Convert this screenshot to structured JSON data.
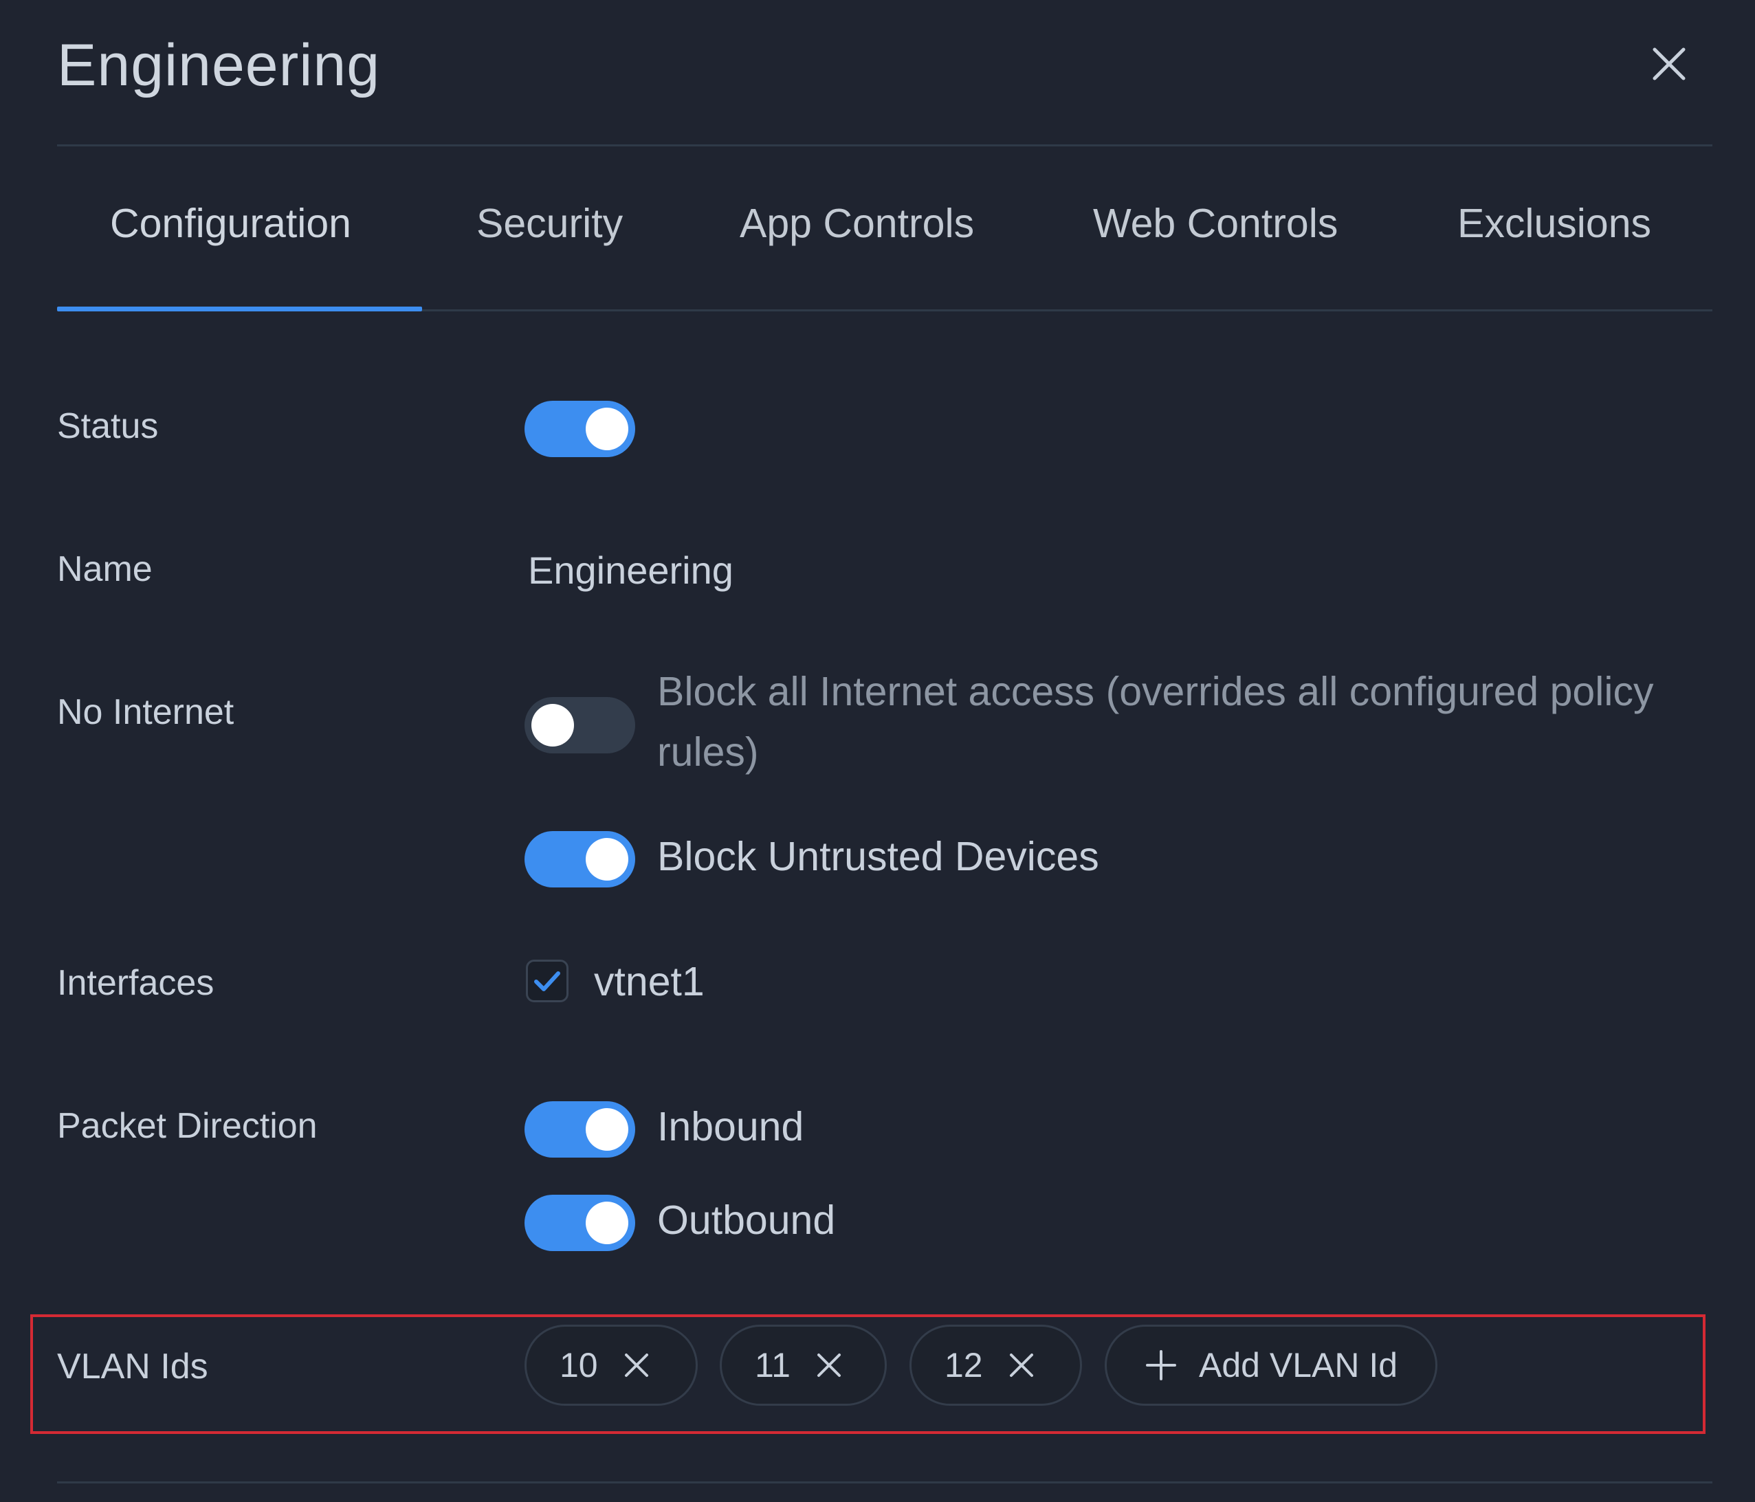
{
  "dialog": {
    "title": "Engineering",
    "close_icon": "close-icon"
  },
  "tabs": [
    {
      "label": "Configuration",
      "active": true
    },
    {
      "label": "Security",
      "active": false
    },
    {
      "label": "App Controls",
      "active": false
    },
    {
      "label": "Web Controls",
      "active": false
    },
    {
      "label": "Exclusions",
      "active": false
    }
  ],
  "form": {
    "status": {
      "label": "Status",
      "enabled": true
    },
    "name": {
      "label": "Name",
      "value": "Engineering"
    },
    "no_internet": {
      "label": "No Internet",
      "block_all": {
        "text": "Block all Internet access (overrides all configured policy rules)",
        "enabled": false
      },
      "block_untrusted": {
        "text": "Block Untrusted Devices",
        "enabled": true
      }
    },
    "interfaces": {
      "label": "Interfaces",
      "items": [
        {
          "name": "vtnet1",
          "checked": true
        }
      ]
    },
    "packet_direction": {
      "label": "Packet Direction",
      "inbound": {
        "text": "Inbound",
        "enabled": true
      },
      "outbound": {
        "text": "Outbound",
        "enabled": true
      }
    },
    "vlan_ids": {
      "label": "VLAN Ids",
      "values": [
        "10",
        "11",
        "12"
      ],
      "add_label": "Add VLAN Id",
      "highlighted": true
    }
  },
  "colors": {
    "background": "#1f2430",
    "accent": "#3d8ef0",
    "highlight": "#d42a34",
    "muted_text": "#8d96a3"
  }
}
